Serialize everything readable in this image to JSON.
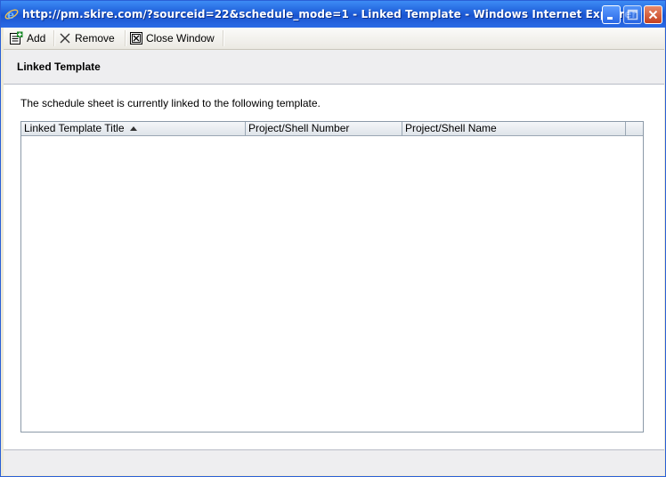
{
  "window": {
    "title": "http://pm.skire.com/?sourceid=22&schedule_mode=1 - Linked Template - Windows Internet Explorer",
    "icon": "ie-icon",
    "controls": [
      "minimize-icon",
      "maximize-icon",
      "close-icon"
    ]
  },
  "toolbar": {
    "add_label": "Add",
    "remove_label": "Remove",
    "close_window_label": "Close Window"
  },
  "page": {
    "title": "Linked Template",
    "description": "The schedule sheet is currently linked to the following template."
  },
  "grid": {
    "columns": [
      "Linked Template Title",
      "Project/Shell Number",
      "Project/Shell Name"
    ],
    "sort": {
      "column": "Linked Template Title",
      "direction": "ascending"
    },
    "rows": []
  },
  "colors": {
    "titlebar": "#1f5fd9",
    "header_band": "#eeeef0",
    "grid_border": "#8c9aa8"
  }
}
